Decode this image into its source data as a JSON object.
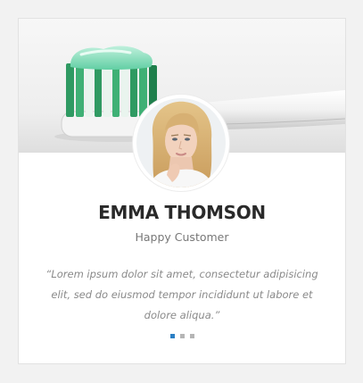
{
  "testimonial": {
    "name": "EMMA THOMSON",
    "role": "Happy Customer",
    "quote": "“Lorem ipsum dolor sit amet, consectetur adipisicing elit, sed do eiusmod tempor incididunt ut labore et dolore aliqua.”"
  },
  "slider": {
    "dot_count": 3,
    "active_index": 0
  },
  "colors": {
    "active_dot": "#2b7fc4",
    "inactive_dot": "#b5b5b5",
    "name_text": "#2a2a2a",
    "role_text": "#777777",
    "quote_text": "#8a8a8a"
  }
}
